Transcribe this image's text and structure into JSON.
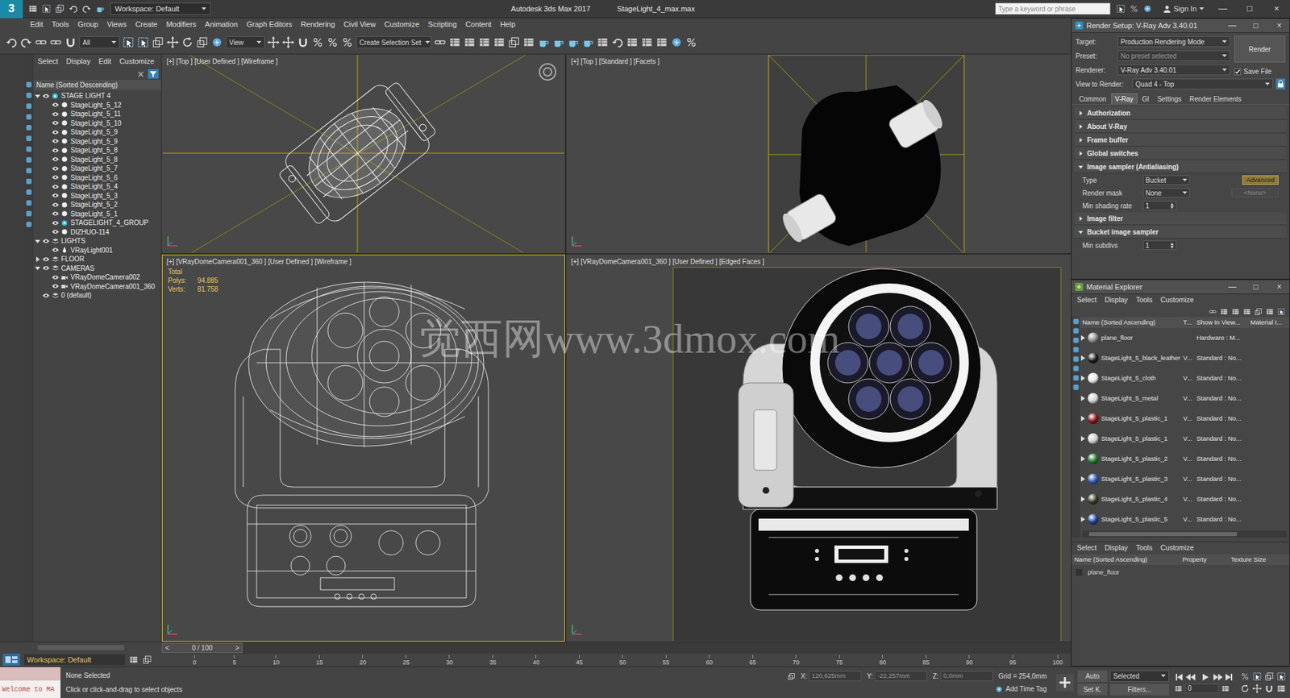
{
  "window": {
    "app_icon": "3",
    "title": "Autodesk 3ds Max 2017",
    "file": "StageLight_4_max.max",
    "workspace": "Workspace: Default",
    "search_placeholder": "Type a keyword or phrase",
    "sign_in": "Sign In",
    "controls": [
      "—",
      "□",
      "×"
    ]
  },
  "menu": [
    "Edit",
    "Tools",
    "Group",
    "Views",
    "Create",
    "Modifiers",
    "Animation",
    "Graph Editors",
    "Rendering",
    "Civil View",
    "Customize",
    "Scripting",
    "Content",
    "Help"
  ],
  "toolbar": {
    "filter": "All",
    "ref": "View",
    "selection_set": "Create Selection Set"
  },
  "scene_explorer": {
    "tabs": [
      "Select",
      "Display",
      "Edit",
      "Customize"
    ],
    "header": "Name (Sorted Descending)",
    "workspace": "Workspace: Default",
    "items": [
      {
        "name": "STAGE LIGHT 4",
        "depth": 0,
        "expanded": true,
        "kind": "group"
      },
      {
        "name": "StageLight_5_12",
        "depth": 1,
        "kind": "object"
      },
      {
        "name": "StageLight_5_11",
        "depth": 1,
        "kind": "object"
      },
      {
        "name": "StageLight_5_10",
        "depth": 1,
        "kind": "object"
      },
      {
        "name": "StageLight_5_9",
        "depth": 1,
        "kind": "object"
      },
      {
        "name": "StageLight_5_9",
        "depth": 1,
        "kind": "object"
      },
      {
        "name": "StageLight_5_8",
        "depth": 1,
        "kind": "object"
      },
      {
        "name": "StageLight_5_8",
        "depth": 1,
        "kind": "object"
      },
      {
        "name": "StageLight_5_7",
        "depth": 1,
        "kind": "object"
      },
      {
        "name": "StageLight_5_6",
        "depth": 1,
        "kind": "object"
      },
      {
        "name": "StageLight_5_4",
        "depth": 1,
        "kind": "object"
      },
      {
        "name": "StageLight_5_3",
        "depth": 1,
        "kind": "object"
      },
      {
        "name": "StageLight_5_2",
        "depth": 1,
        "kind": "object"
      },
      {
        "name": "StageLight_5_1",
        "depth": 1,
        "kind": "object"
      },
      {
        "name": "STAGELIGHT_4_GROUP",
        "depth": 1,
        "kind": "group"
      },
      {
        "name": "DIZHUO-114",
        "depth": 1,
        "kind": "object"
      },
      {
        "name": "LIGHTS",
        "depth": 0,
        "expanded": true,
        "kind": "layer"
      },
      {
        "name": "VRayLight001",
        "depth": 1,
        "kind": "light"
      },
      {
        "name": "FLOOR",
        "depth": 0,
        "expanded": false,
        "kind": "layer"
      },
      {
        "name": "CAMERAS",
        "depth": 0,
        "expanded": true,
        "kind": "layer"
      },
      {
        "name": "VRayDomeCamera002",
        "depth": 1,
        "kind": "camera"
      },
      {
        "name": "VRayDomeCamera001_360",
        "depth": 1,
        "kind": "camera"
      },
      {
        "name": "0 (default)",
        "depth": 0,
        "kind": "layer"
      }
    ]
  },
  "viewports": [
    {
      "label": "[+] [Top ] [User Defined ] [Wireframe ]",
      "selected": false,
      "kind": "topwire"
    },
    {
      "label": "[+] [Top ] [Standard ] [Facets ]",
      "selected": false,
      "kind": "toprender"
    },
    {
      "label": "[+] [VRayDomeCamera001_360 ] [User Defined ] [Wireframe ]",
      "selected": true,
      "kind": "camwire",
      "stats_title": "Total",
      "stats": [
        {
          "label": "Polys:",
          "value": "94.885"
        },
        {
          "label": "Verts:",
          "value": "81.758"
        }
      ]
    },
    {
      "label": "[+] [VRayDomeCamera001_360 ] [User Defined ] [Edged Faces ]",
      "selected": false,
      "kind": "camshaded"
    }
  ],
  "watermark": "觉西网www.3dmox.com",
  "render_setup": {
    "title": "Render Setup: V-Ray Adv 3.40.01",
    "controls": [
      "—",
      "□",
      "×"
    ],
    "fields": [
      {
        "label": "Target:",
        "value": "Production Rendering Mode"
      },
      {
        "label": "Preset:",
        "value": "No preset selected"
      },
      {
        "label": "Renderer:",
        "value": "V-Ray Adv 3.40.01"
      }
    ],
    "save_file": {
      "label": "Save File",
      "checked": true
    },
    "view_to_render": {
      "label": "View to Render:",
      "value": "Quad 4 - Top"
    },
    "render_button": "Render",
    "tabs": [
      {
        "label": "Common",
        "selected": false
      },
      {
        "label": "V-Ray",
        "selected": true
      },
      {
        "label": "GI",
        "selected": false
      },
      {
        "label": "Settings",
        "selected": false
      },
      {
        "label": "Render Elements",
        "selected": false
      }
    ],
    "rollouts": [
      {
        "title": "Authorization",
        "expanded": false
      },
      {
        "title": "About V-Ray",
        "expanded": false
      },
      {
        "title": "Frame buffer",
        "expanded": false
      },
      {
        "title": "Global switches",
        "expanded": false
      },
      {
        "title": "Image sampler (Antialiasing)",
        "expanded": true,
        "rows": [
          {
            "label": "Type",
            "value": "Bucket",
            "extra": "Advanced",
            "kind": "button"
          },
          {
            "label": "Render mask",
            "value": "None",
            "extra": "<None>",
            "kind": "field"
          },
          {
            "label": "Min shading rate",
            "value": "1",
            "kind": "spinner"
          }
        ]
      },
      {
        "title": "Image filter",
        "expanded": false
      },
      {
        "title": "Bucket image sampler",
        "expanded": true,
        "rows": [
          {
            "label": "Min subdivs",
            "value": "1",
            "kind": "spinner"
          }
        ]
      }
    ]
  },
  "material_explorer": {
    "title": "Material Explorer",
    "controls": [
      "—",
      "□",
      "×"
    ],
    "menu": [
      "Select",
      "Display",
      "Tools",
      "Customize"
    ],
    "columns": [
      "Name (Sorted Ascending)",
      "T...",
      "Show In View...",
      "Material I..."
    ],
    "rows": [
      {
        "name": "plane_floor",
        "show": "Hardware : M...",
        "color": "#8a8a8a"
      },
      {
        "name": "StageLight_5_black_leather",
        "type": "V...",
        "show": "Standard : No...",
        "color": "#1c1c1c"
      },
      {
        "name": "StageLight_5_cloth",
        "type": "V...",
        "show": "Standard : No...",
        "color": "#e6e6e6"
      },
      {
        "name": "StageLight_5_metal",
        "type": "V...",
        "show": "Standard : No...",
        "color": "#d0d0d0"
      },
      {
        "name": "StageLight_5_plastic_1",
        "type": "V...",
        "show": "Standard : No...",
        "color": "#8e1010"
      },
      {
        "name": "StageLight_5_plastic_1",
        "type": "V...",
        "show": "Standard : No...",
        "color": "#cfcfcf"
      },
      {
        "name": "StageLight_5_plastic_2",
        "type": "V...",
        "show": "Standard : No...",
        "color": "#1f7a2a"
      },
      {
        "name": "StageLight_5_plastic_3",
        "type": "V...",
        "show": "Standard : No...",
        "color": "#2f57b8"
      },
      {
        "name": "StageLight_5_plastic_4",
        "type": "V...",
        "show": "Standard : No...",
        "color": "#3a3a26"
      },
      {
        "name": "StageLight_5_plastic_5",
        "type": "V...",
        "show": "Standard : No...",
        "color": "#1f3f9a"
      }
    ],
    "lower_menu": [
      "Select",
      "Display",
      "Tools",
      "Customize"
    ],
    "lower_columns": [
      "Name (Sorted Ascending)",
      "Property",
      "Texture Size"
    ],
    "lower_rows": [
      "plane_floor"
    ]
  },
  "timeline": {
    "prev": "<",
    "frame": "0 / 100",
    "next": ">",
    "ticks": [
      "0",
      "5",
      "10",
      "15",
      "20",
      "25",
      "30",
      "35",
      "40",
      "45",
      "50",
      "55",
      "60",
      "65",
      "70",
      "75",
      "80",
      "85",
      "90",
      "95",
      "100"
    ]
  },
  "status": {
    "listener": "Welcome to MA",
    "selection": "None Selected",
    "prompt": "Click or click-and-drag to select objects",
    "x_label": "X:",
    "x": "120,625mm",
    "y_label": "Y:",
    "y": "-22,257mm",
    "z_label": "Z:",
    "z": "0,0mm",
    "grid": "Grid = 254,0mm",
    "time_tag": "Add Time Tag",
    "auto": "Auto",
    "set_key": "Set K.",
    "key_mode": "Selected",
    "filters": "Filters...",
    "frame": "0"
  }
}
